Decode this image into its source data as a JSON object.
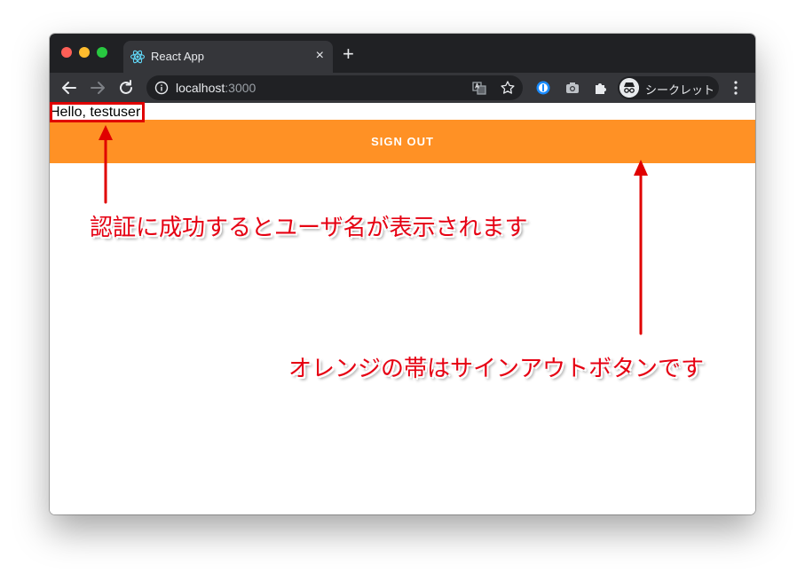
{
  "browser": {
    "tab": {
      "title": "React App",
      "close_glyph": "×",
      "favicon": "react-logo-icon"
    },
    "new_tab_glyph": "+",
    "url_host": "localhost",
    "url_port": ":3000",
    "profile_label": "シークレット",
    "icons": [
      "back-arrow-icon",
      "forward-arrow-icon",
      "reload-icon",
      "info-icon",
      "translate-icon",
      "star-icon",
      "password-extension-icon",
      "camera-extension-icon",
      "puzzle-extensions-icon",
      "incognito-icon",
      "menu-dots-icon"
    ]
  },
  "page": {
    "greeting": "Hello, testuser",
    "sign_out_label": "SIGN OUT"
  },
  "annotations": {
    "username_note": "認証に成功するとユーザ名が表示されます",
    "button_note": "オレンジの帯はサインアウトボタンです",
    "color": "#e60012"
  },
  "colors": {
    "button": "#ff9125",
    "titlebar": "#202124",
    "toolbar": "#35363a"
  }
}
